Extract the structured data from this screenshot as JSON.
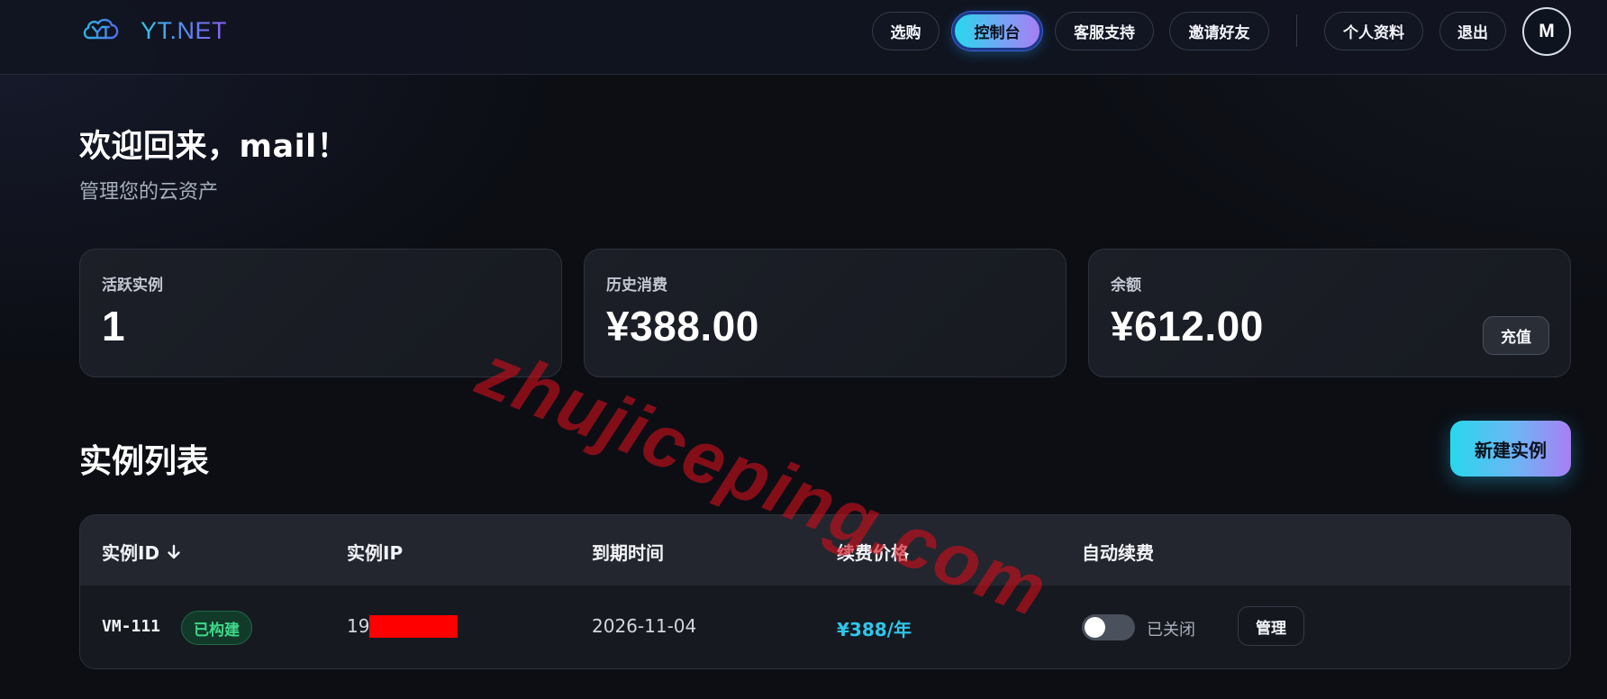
{
  "brand": {
    "name": "YT.NET",
    "logo_icon": "cloud-logo-icon"
  },
  "nav": {
    "items": [
      {
        "label": "选购",
        "active": false
      },
      {
        "label": "控制台",
        "active": true
      },
      {
        "label": "客服支持",
        "active": false
      },
      {
        "label": "邀请好友",
        "active": false
      }
    ],
    "profile_label": "个人资料",
    "logout_label": "退出",
    "avatar_initial": "M"
  },
  "greeting": {
    "title": "欢迎回来，mail！",
    "subtitle": "管理您的云资产"
  },
  "stats": {
    "active_instances": {
      "label": "活跃实例",
      "value": "1"
    },
    "total_spend": {
      "label": "历史消费",
      "value": "¥388.00"
    },
    "balance": {
      "label": "余额",
      "value": "¥612.00",
      "action_label": "充值"
    }
  },
  "instances": {
    "title": "实例列表",
    "new_button_label": "新建实例",
    "columns": [
      "实例ID",
      "实例IP",
      "到期时间",
      "续费价格",
      "自动续费"
    ],
    "sort_icon": "arrow-down-icon",
    "rows": [
      {
        "id": "VM-111",
        "status": "已构建",
        "ip_visible": "19",
        "ip_redacted": true,
        "expiry": "2026-11-04",
        "price": "¥388/年",
        "auto_renew": false,
        "auto_renew_label": "已关闭",
        "manage_label": "管理"
      }
    ]
  },
  "watermark": {
    "text": "zhujiceping.com"
  },
  "colors": {
    "accent_cyan": "#27d8ec",
    "accent_purple": "#a87ff4",
    "price_cyan": "#2ec6ec",
    "status_green": "#3fd889",
    "redaction_red": "#ff0000",
    "watermark_red": "#cd0e1c"
  }
}
